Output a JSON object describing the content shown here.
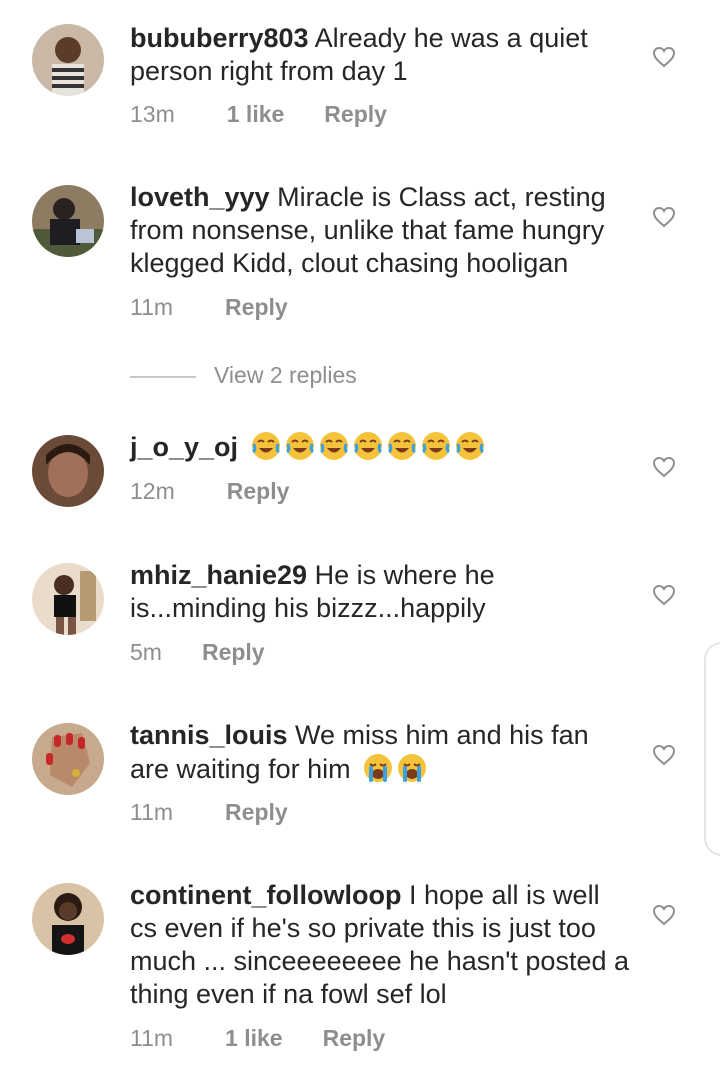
{
  "comments": [
    {
      "username": "bububerry803",
      "text": " Already he was a quiet person right from day 1",
      "time": "13m",
      "likes": "1 like",
      "reply": "Reply"
    },
    {
      "username": "loveth_yyy",
      "text": " Miracle is Class act, resting from nonsense, unlike that fame hungry klegged Kidd, clout chasing hooligan",
      "time": "11m",
      "likes": "",
      "reply": "Reply",
      "view_replies": "View 2 replies"
    },
    {
      "username": "j_o_y_oj",
      "text": "",
      "emoji": [
        "joy",
        "joy",
        "joy",
        "joy",
        "joy",
        "joy",
        "joy"
      ],
      "time": "12m",
      "likes": "",
      "reply": "Reply"
    },
    {
      "username": "mhiz_hanie29",
      "text": " He is where he is...minding his bizzz...happily",
      "time": "5m",
      "likes": "",
      "reply": "Reply"
    },
    {
      "username": "tannis_louis",
      "text": " We miss him and his fan are waiting for him",
      "emoji": [
        "crying",
        "crying"
      ],
      "time": "11m",
      "likes": "",
      "reply": "Reply"
    },
    {
      "username": "continent_followloop",
      "text": " I hope all is well cs even if he's so private this is just too much ... sinceeeeeeee he hasn't posted a thing even if na fowl sef lol",
      "time": "11m",
      "likes": "1 like",
      "reply": "Reply"
    }
  ],
  "icons": {
    "like": "heart-outline-icon"
  }
}
